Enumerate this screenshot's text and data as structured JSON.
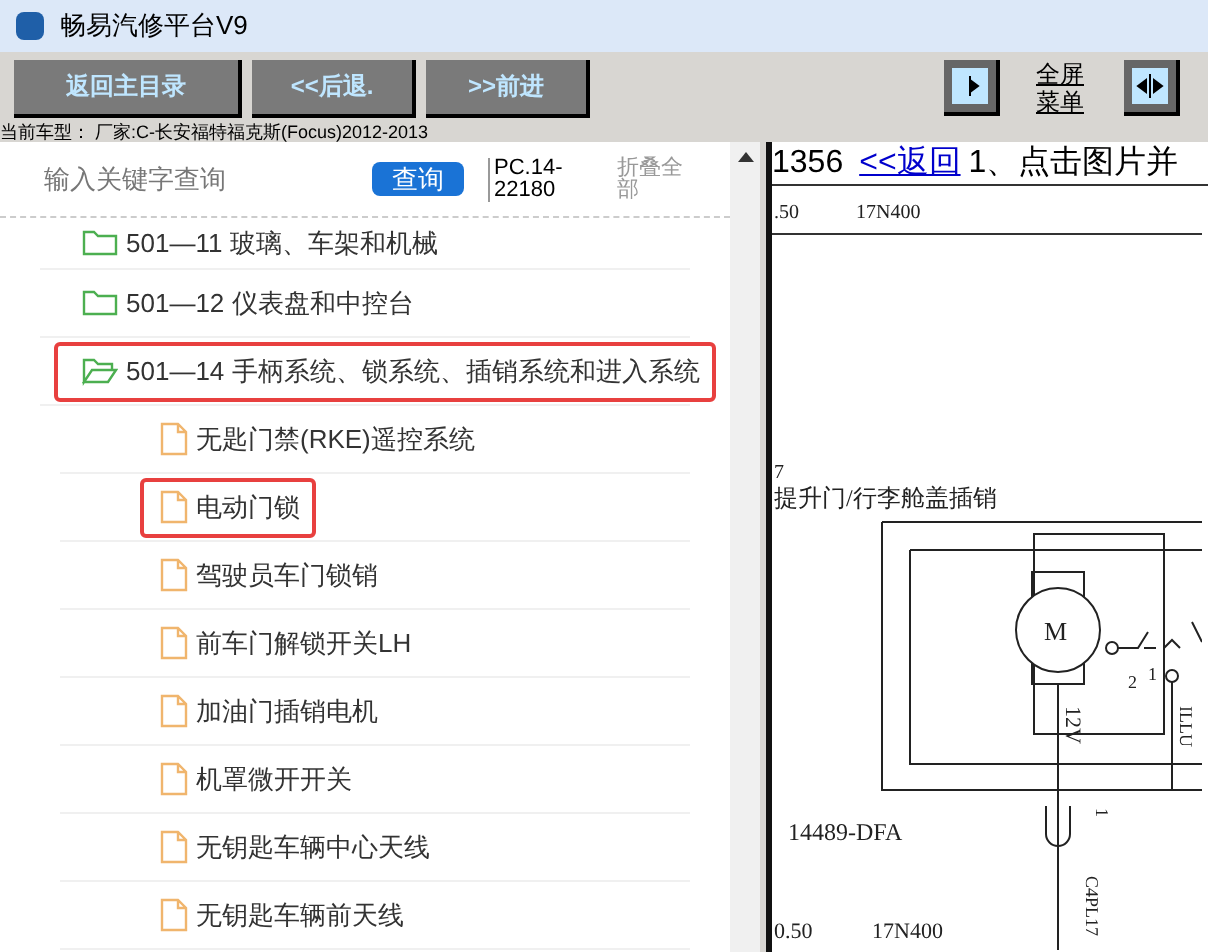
{
  "window": {
    "title": "畅易汽修平台V9"
  },
  "toolbar": {
    "buttons": [
      "返回主目录",
      "<<后退.",
      ">>前进"
    ],
    "fullscreen_link": "全屏菜单"
  },
  "car_model": "当前车型： 厂家:C-长安福特福克斯(Focus)2012-2013",
  "search": {
    "placeholder": "输入关键字查询",
    "button": "查询",
    "code": "PC.14-22180",
    "collapse_all": "折叠全部"
  },
  "tree": [
    {
      "kind": "folder",
      "label": "501—11 玻璃、车架和机械",
      "expanded": false,
      "highlighted": false
    },
    {
      "kind": "folder",
      "label": "501—12 仪表盘和中控台",
      "expanded": false,
      "highlighted": false
    },
    {
      "kind": "folder",
      "label": "501—14 手柄系统、锁系统、插销系统和进入系统",
      "expanded": true,
      "highlighted": true,
      "children": [
        {
          "kind": "file",
          "label": "无匙门禁(RKE)遥控系统",
          "highlighted": false
        },
        {
          "kind": "file",
          "label": "电动门锁",
          "highlighted": true
        },
        {
          "kind": "file",
          "label": "驾驶员车门锁销",
          "highlighted": false
        },
        {
          "kind": "file",
          "label": "前车门解锁开关LH",
          "highlighted": false
        },
        {
          "kind": "file",
          "label": "加油门插销电机",
          "highlighted": false
        },
        {
          "kind": "file",
          "label": "机罩微开开关",
          "highlighted": false
        },
        {
          "kind": "file",
          "label": "无钥匙车辆中心天线",
          "highlighted": false
        },
        {
          "kind": "file",
          "label": "无钥匙车辆前天线",
          "highlighted": false
        }
      ]
    }
  ],
  "document": {
    "page": "1356",
    "back_link": "<<返回",
    "instruction": "1、点击图片并",
    "diagram_labels": [
      ".50",
      "17N400",
      "7",
      "提升门/行李舱盖插销",
      "M",
      "2",
      "1",
      "12V",
      "ILLU",
      "14489-DFA",
      "1",
      "C4PL17",
      "0.50",
      "17N400"
    ]
  }
}
